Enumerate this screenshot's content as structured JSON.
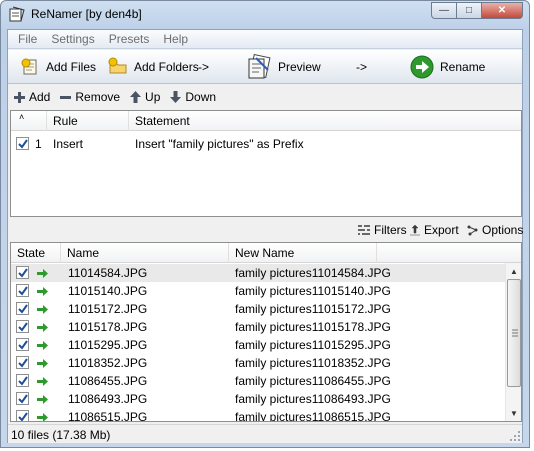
{
  "window": {
    "title": "ReNamer  [by den4b]",
    "controls": {
      "minimize": "—",
      "maximize": "□",
      "close": "✕"
    }
  },
  "menu": [
    "File",
    "Settings",
    "Presets",
    "Help"
  ],
  "toolbar": {
    "add_files": "Add Files",
    "add_folders": "Add Folders",
    "arrow1": "->",
    "preview": "Preview",
    "arrow2": "->",
    "rename": "Rename"
  },
  "rule_actions": {
    "add": "Add",
    "remove": "Remove",
    "up": "Up",
    "down": "Down"
  },
  "rules_table": {
    "columns": [
      "Rule",
      "Statement"
    ],
    "rows": [
      {
        "checked": true,
        "index": "1",
        "rule": "Insert",
        "statement": "Insert \"family pictures\" as Prefix"
      }
    ]
  },
  "file_actions": {
    "filters": "Filters",
    "export": "Export",
    "options": "Options"
  },
  "files_table": {
    "columns": [
      "State",
      "Name",
      "New Name"
    ],
    "rows": [
      {
        "checked": true,
        "name": "11014584.JPG",
        "new_name": "family pictures11014584.JPG"
      },
      {
        "checked": true,
        "name": "11015140.JPG",
        "new_name": "family pictures11015140.JPG"
      },
      {
        "checked": true,
        "name": "11015172.JPG",
        "new_name": "family pictures11015172.JPG"
      },
      {
        "checked": true,
        "name": "11015178.JPG",
        "new_name": "family pictures11015178.JPG"
      },
      {
        "checked": true,
        "name": "11015295.JPG",
        "new_name": "family pictures11015295.JPG"
      },
      {
        "checked": true,
        "name": "11018352.JPG",
        "new_name": "family pictures11018352.JPG"
      },
      {
        "checked": true,
        "name": "11086455.JPG",
        "new_name": "family pictures11086455.JPG"
      },
      {
        "checked": true,
        "name": "11086493.JPG",
        "new_name": "family pictures11086493.JPG"
      },
      {
        "checked": true,
        "name": "11086515.JPG",
        "new_name": "family pictures11086515.JPG"
      }
    ]
  },
  "status": {
    "text": "10 files (17.38 Mb)"
  },
  "colors": {
    "accent_green": "#2e9a2e",
    "check_blue": "#1f4f9a",
    "window_frame": "#bcd0e8"
  }
}
